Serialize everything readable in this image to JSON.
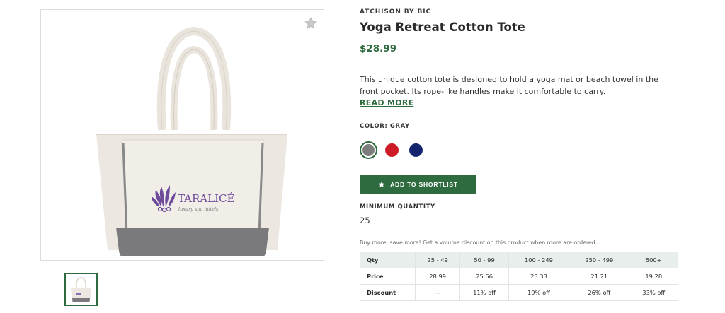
{
  "product": {
    "brand": "ATCHISON BY BIC",
    "title": "Yoga Retreat Cotton Tote",
    "price": "$28.99",
    "description": "This unique cotton tote is designed to hold a yoga mat or beach towel in the front pocket. Its rope-like handles make it comfortable to carry.",
    "read_more": "READ MORE",
    "imprint_logo": "TARALICÉ",
    "imprint_tagline": "luxury spa hotels"
  },
  "color": {
    "label": "COLOR: GRAY",
    "swatches": [
      {
        "name": "gray",
        "hex": "#7d7d7d",
        "selected": true
      },
      {
        "name": "red",
        "hex": "#cc1b24",
        "selected": false
      },
      {
        "name": "navy",
        "hex": "#14256f",
        "selected": false
      }
    ]
  },
  "actions": {
    "shortlist_label": "ADD TO SHORTLIST",
    "star_icon": "star-icon",
    "favorite_icon": "star-outline-icon"
  },
  "minimum": {
    "label": "MINIMUM QUANTITY",
    "value": "25"
  },
  "promo": "Buy more, save more! Get a volume discount on this product when more are ordered.",
  "pricing": {
    "headers": [
      "Qty",
      "25 - 49",
      "50 - 99",
      "100 - 249",
      "250 - 499",
      "500+"
    ],
    "rows": [
      [
        "Price",
        "28.99",
        "25.66",
        "23.33",
        "21.21",
        "19.28"
      ],
      [
        "Discount",
        "--",
        "11% off",
        "19% off",
        "26% off",
        "33% off"
      ]
    ]
  },
  "colors": {
    "accent": "#2e6b3f",
    "table_header": "#e8eeec"
  }
}
